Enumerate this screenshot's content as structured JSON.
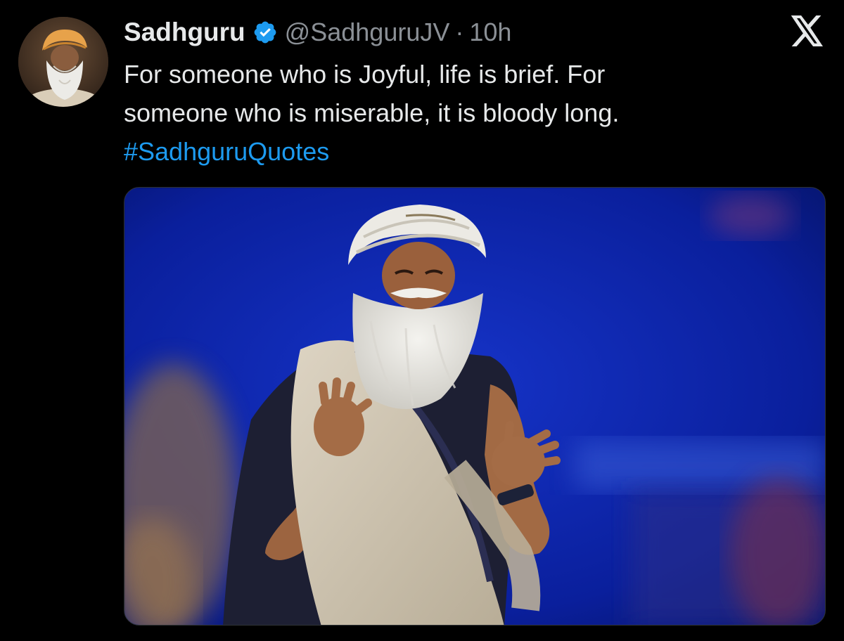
{
  "tweet": {
    "author_name": "Sadhguru",
    "handle": "@SadhguruJV",
    "separator": "·",
    "time": "10h",
    "text_line1": "For someone who is Joyful, life is brief. For",
    "text_line2": "someone who is miserable, it is bloody long.",
    "hashtag": "#SadhguruQuotes"
  },
  "icons": {
    "verified": "verified-badge-icon",
    "brand": "x-logo-icon"
  },
  "colors": {
    "background": "#000000",
    "text": "#e7e9ea",
    "muted": "#8b9096",
    "link": "#1d9bf0",
    "verified_badge": "#1d9bf0",
    "photo_backdrop": "#0a1f9c"
  }
}
